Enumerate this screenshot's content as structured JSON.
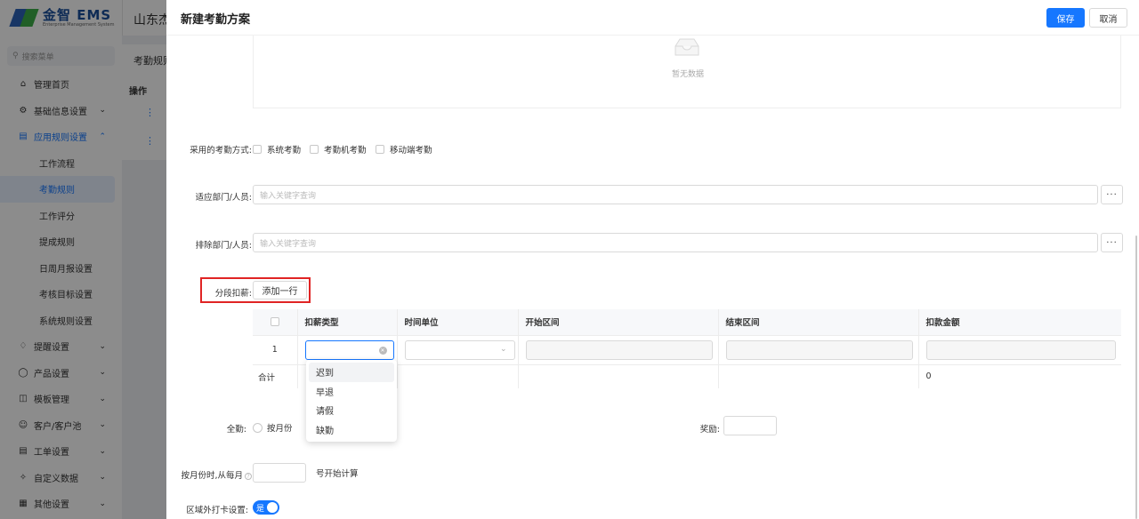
{
  "app": {
    "logo_name": "金智 EMS",
    "logo_sub": "Enterprise Management System",
    "company": "山东杰",
    "brand_blue": "#1677ff",
    "highlight_red": "#e02424"
  },
  "sidebar": {
    "search_placeholder": "搜索菜单",
    "items": [
      {
        "label": "管理首页",
        "icon": "home-icon"
      },
      {
        "label": "基础信息设置",
        "icon": "settings-icon"
      },
      {
        "label": "应用规则设置",
        "icon": "document-icon"
      },
      {
        "label": "提醒设置",
        "icon": "bell-icon"
      },
      {
        "label": "产品设置",
        "icon": "box-icon"
      },
      {
        "label": "模板管理",
        "icon": "template-icon"
      },
      {
        "label": "客户/客户池",
        "icon": "customer-icon"
      },
      {
        "label": "工单设置",
        "icon": "ticket-icon"
      },
      {
        "label": "自定义数据",
        "icon": "custom-data-icon"
      },
      {
        "label": "其他设置",
        "icon": "grid-icon"
      }
    ],
    "sub_items": [
      "工作流程",
      "考勤规则",
      "工作评分",
      "提成规则",
      "日周月报设置",
      "考核目标设置",
      "系统规则设置"
    ]
  },
  "background": {
    "page_title": "考勤规则",
    "column_header": "操作"
  },
  "drawer": {
    "title": "新建考勤方案",
    "save_label": "保存",
    "cancel_label": "取消",
    "empty_text": "暂无数据",
    "attendance_method_label": "采用的考勤方式:",
    "attendance_methods": [
      "系统考勤",
      "考勤机考勤",
      "移动端考勤"
    ],
    "apply_label": "适应部门/人员:",
    "apply_placeholder": "输入关键字查询",
    "exclude_label": "排除部门/人员:",
    "exclude_placeholder": "输入关键字查询",
    "more_label": "···",
    "deduction_label": "分段扣薪:",
    "add_row_label": "添加一行",
    "table": {
      "headers": [
        "扣薪类型",
        "时间单位",
        "开始区间",
        "结束区间",
        "扣款金额"
      ],
      "row_index": "1",
      "sum_label": "合计",
      "sum_value": "0"
    },
    "dropdown_options": [
      "迟到",
      "早退",
      "请假",
      "缺勤"
    ],
    "full_attendance_label": "全勤:",
    "full_attendance_option": "按月份",
    "reward_label": "奖励:",
    "monthly_prefix": "按月份时,从每月",
    "monthly_suffix": "号开始计算",
    "out_area_label": "区域外打卡设置:",
    "out_area_switch": "是"
  }
}
